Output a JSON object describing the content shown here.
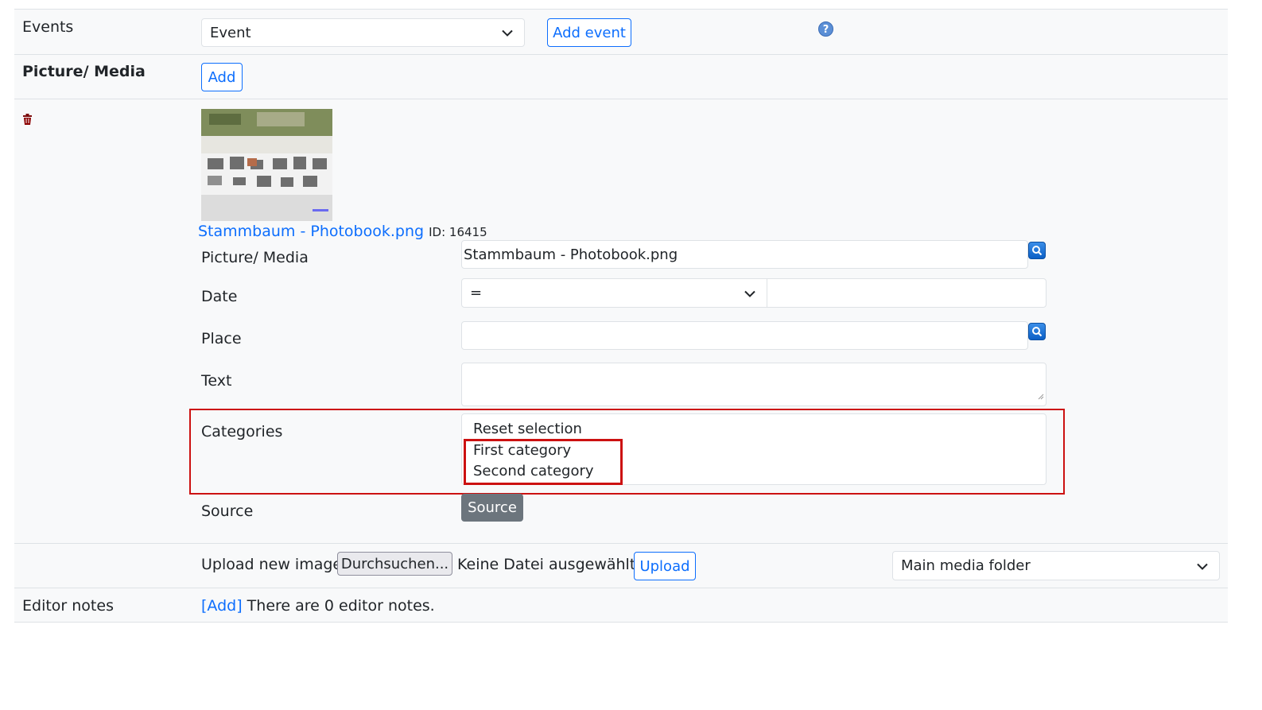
{
  "events": {
    "label": "Events",
    "select_value": "Event",
    "add_button": "Add event"
  },
  "media_section": {
    "label": "Picture/ Media",
    "add_button": "Add"
  },
  "media_item": {
    "file_link": "Stammbaum - Photobook.png",
    "id_text": "ID: 16415",
    "fields": {
      "picture_label": "Picture/ Media",
      "picture_value": "Stammbaum - Photobook.png",
      "date_label": "Date",
      "date_operator": "=",
      "date_value": "",
      "place_label": "Place",
      "place_value": "",
      "text_label": "Text",
      "text_value": "",
      "categories_label": "Categories",
      "categories_options": [
        "Reset selection",
        "First category",
        "Second category"
      ],
      "source_label": "Source",
      "source_button": "Source"
    }
  },
  "upload": {
    "label": "Upload new image",
    "browse_button": "Durchsuchen...",
    "no_file_text": "Keine Datei ausgewählt.",
    "upload_button": "Upload",
    "folder_select": "Main media folder"
  },
  "editor_notes": {
    "label": "Editor notes",
    "add_link": "[Add]",
    "count_text": "There are 0 editor notes."
  },
  "colors": {
    "accent": "#0d6efd",
    "highlight": "#cc1111",
    "row_bg": "#f8f9fa",
    "source_button": "#6c757d"
  }
}
